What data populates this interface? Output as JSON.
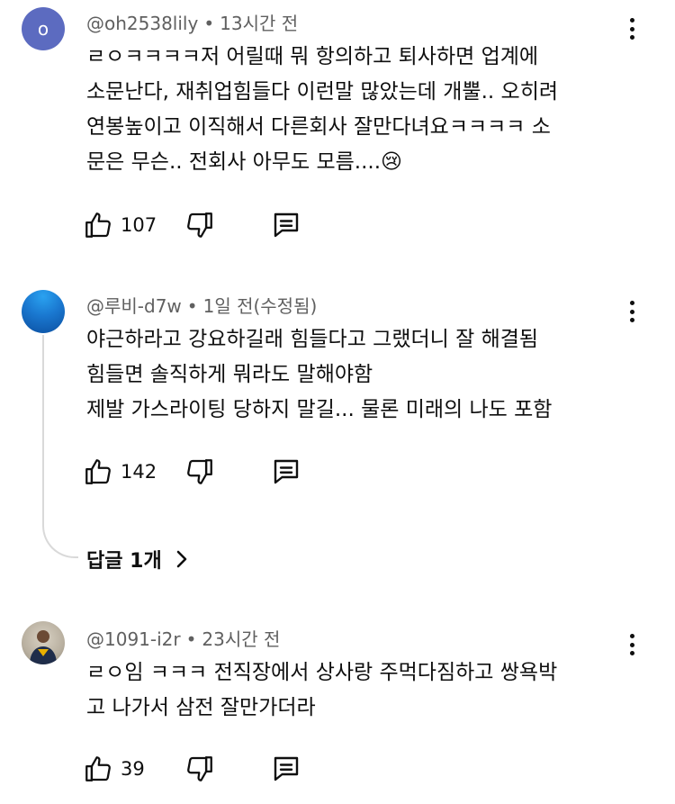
{
  "comments": [
    {
      "avatar_letter": "o",
      "author": "@oh2538lily",
      "separator": "•",
      "time": "13시간 전",
      "text": "ㄹㅇㅋㅋㅋㅋ저 어릴때 뭐 항의하고 퇴사하면 업계에\n소문난다, 재취업힘들다 이런말 많았는데 개뿔.. 오히려\n연봉높이고 이직해서 다른회사 잘만다녀요ㅋㅋㅋㅋ 소\n문은 무슨.. 전회사 아무도 모름....😢",
      "likes": "107"
    },
    {
      "author": "@루비-d7w",
      "separator": "•",
      "time": "1일 전(수정됨)",
      "text": "야근하라고 강요하길래 힘들다고 그랬더니 잘 해결됨\n힘들면 솔직하게 뭐라도 말해야함\n제발 가스라이팅 당하지 말길... 물론 미래의 나도 포함",
      "likes": "142",
      "replies_label": "답글 1개"
    },
    {
      "author": "@1091-i2r",
      "separator": "•",
      "time": "23시간 전",
      "text": "ㄹㅇ임 ㅋㅋㅋ 전직장에서 상사랑 주먹다짐하고 쌍욕박\n고 나가서 삼전 잘만가더라",
      "likes": "39"
    }
  ],
  "icons": {
    "like": "thumbs-up-outline-icon",
    "dislike": "thumbs-down-outline-icon",
    "reply": "reply-comment-icon",
    "menu": "kebab-menu-icon",
    "expand": "chevron-right-icon"
  },
  "colors": {
    "text": "#0f0f0f",
    "meta": "#606060",
    "avatar_o": "#5c6bc0",
    "thread_line": "#d9d9d9"
  }
}
